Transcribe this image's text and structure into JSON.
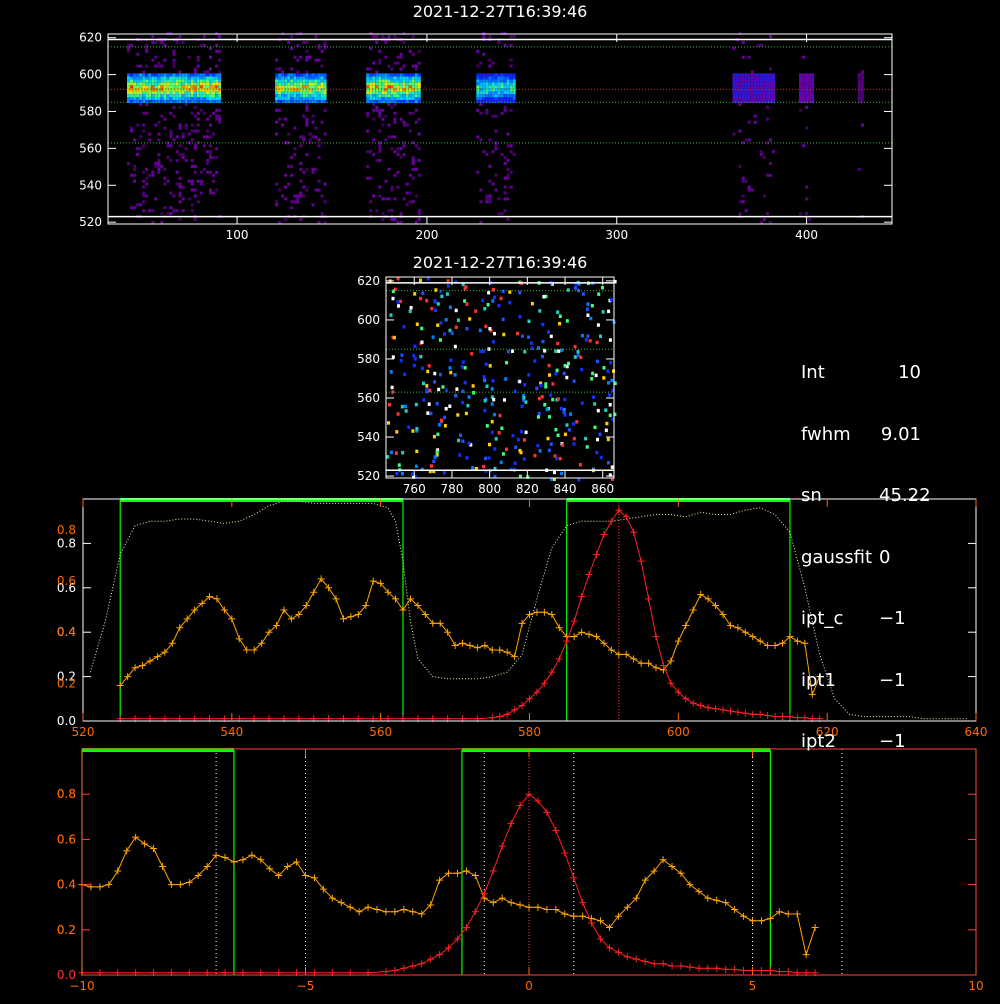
{
  "timestamp": "2021-12-27T16:39:46",
  "info_panel": [
    {
      "key": "Int",
      "value": "10"
    },
    {
      "key": "fwhm",
      "value": "9.01"
    },
    {
      "key": "sn",
      "value": "45.22"
    },
    {
      "key": "gaussfit",
      "value": "0"
    },
    {
      "key": "ipt_c",
      "value": "−1"
    },
    {
      "key": "ipt1",
      "value": "−1"
    },
    {
      "key": "ipt2",
      "value": "−1"
    }
  ],
  "colors": {
    "frame": "#ffffff",
    "window": "#00ff00",
    "line_profile": "#ff2020",
    "spectrum": "#ffa500",
    "transmission": "#e0ffb0",
    "left_axis_orange": "#ff6a00",
    "left_axis_red": "#ff3030"
  },
  "chart_data": [
    {
      "type": "heatmap",
      "title": "2021-12-27T16:39:46",
      "xlim": [
        32,
        445
      ],
      "ylim": [
        519,
        622
      ],
      "xticks": [
        100,
        200,
        300,
        400
      ],
      "yticks": [
        520,
        540,
        560,
        580,
        600,
        620
      ],
      "strong_rows": [
        584,
        600
      ],
      "faint_rows": [
        522,
        618
      ],
      "columns": [
        {
          "x0": 42,
          "x1": 91,
          "strength": 1.0
        },
        {
          "x0": 120,
          "x1": 147,
          "strength": 0.95
        },
        {
          "x0": 168,
          "x1": 196,
          "strength": 1.0
        },
        {
          "x0": 226,
          "x1": 246,
          "strength": 0.75
        },
        {
          "x0": 361,
          "x1": 383,
          "strength": 0.25
        },
        {
          "x0": 396,
          "x1": 404,
          "strength": 0.2
        },
        {
          "x0": 427,
          "x1": 429,
          "strength": 0.1
        }
      ],
      "hlines": [
        {
          "y": 523,
          "style": "solid-white"
        },
        {
          "y": 563,
          "style": "dotted-green"
        },
        {
          "y": 585,
          "style": "dotted-green"
        },
        {
          "y": 592,
          "style": "dotted-red"
        },
        {
          "y": 615,
          "style": "dotted-green"
        },
        {
          "y": 619,
          "style": "solid-white"
        }
      ]
    },
    {
      "type": "scatter",
      "title": "2021-12-27T16:39:46",
      "xlim": [
        745,
        866
      ],
      "ylim": [
        519,
        622
      ],
      "xticks": [
        760,
        780,
        800,
        820,
        840,
        860
      ],
      "yticks": [
        520,
        540,
        560,
        580,
        600,
        620
      ],
      "hlines": [
        {
          "y": 523,
          "style": "solid-white"
        },
        {
          "y": 563,
          "style": "dotted-green"
        },
        {
          "y": 585,
          "style": "dotted-green"
        },
        {
          "y": 615,
          "style": "dotted-green"
        },
        {
          "y": 619,
          "style": "solid-white"
        }
      ]
    },
    {
      "type": "line",
      "xlim": [
        520,
        640
      ],
      "ylim": [
        0,
        1.0
      ],
      "xticks": [
        520,
        540,
        560,
        580,
        600,
        620,
        640
      ],
      "yticks_white": [
        "0.0",
        "0.2",
        "0.4",
        "0.6",
        "0.8"
      ],
      "yticks_orange": [
        "0.2",
        "0.4",
        "0.6",
        "0.8"
      ],
      "windows": [
        {
          "x0": 525,
          "x1": 563
        },
        {
          "x0": 585,
          "x1": 615
        }
      ],
      "center_line_x": 592,
      "series": [
        {
          "role": "transmission",
          "x": [
            521,
            523,
            525,
            527,
            529,
            531,
            533,
            535,
            537,
            539,
            541,
            543,
            545,
            547,
            549,
            551,
            553,
            555,
            557,
            559,
            561,
            562,
            563,
            564,
            565,
            567,
            569,
            571,
            573,
            575,
            577,
            579,
            581,
            583,
            585,
            587,
            589,
            591,
            593,
            595,
            597,
            599,
            601,
            603,
            605,
            607,
            609,
            611,
            613,
            615,
            617,
            619,
            621,
            623,
            625,
            627,
            629,
            631,
            633,
            635,
            637,
            639
          ],
          "y": [
            0.22,
            0.45,
            0.75,
            0.88,
            0.9,
            0.9,
            0.91,
            0.91,
            0.9,
            0.89,
            0.9,
            0.93,
            0.97,
            0.99,
            0.99,
            0.98,
            0.98,
            0.98,
            0.98,
            0.98,
            0.96,
            0.9,
            0.72,
            0.45,
            0.28,
            0.2,
            0.19,
            0.19,
            0.19,
            0.2,
            0.22,
            0.3,
            0.55,
            0.78,
            0.88,
            0.9,
            0.9,
            0.9,
            0.91,
            0.92,
            0.93,
            0.93,
            0.92,
            0.94,
            0.93,
            0.93,
            0.95,
            0.96,
            0.93,
            0.85,
            0.6,
            0.3,
            0.1,
            0.03,
            0.02,
            0.02,
            0.02,
            0.02,
            0.01,
            0.01,
            0.01,
            0.01
          ]
        },
        {
          "role": "spectrum",
          "x": [
            525,
            526,
            527,
            528,
            529,
            530,
            531,
            532,
            533,
            534,
            535,
            536,
            537,
            538,
            539,
            540,
            541,
            542,
            543,
            544,
            545,
            546,
            547,
            548,
            549,
            550,
            551,
            552,
            553,
            554,
            555,
            556,
            557,
            558,
            559,
            560,
            561,
            562,
            563,
            564,
            565,
            566,
            567,
            568,
            569,
            570,
            571,
            572,
            573,
            574,
            575,
            576,
            577,
            578,
            579,
            580,
            581,
            582,
            583,
            584,
            585,
            586,
            587,
            588,
            589,
            590,
            591,
            592,
            593,
            594,
            595,
            596,
            597,
            598,
            599,
            600,
            601,
            602,
            603,
            604,
            605,
            606,
            607,
            608,
            609,
            610,
            611,
            612,
            613,
            614,
            615,
            616,
            617,
            618,
            619
          ],
          "y": [
            0.16,
            0.2,
            0.24,
            0.25,
            0.27,
            0.29,
            0.31,
            0.35,
            0.42,
            0.46,
            0.5,
            0.53,
            0.56,
            0.55,
            0.5,
            0.46,
            0.37,
            0.32,
            0.32,
            0.35,
            0.4,
            0.43,
            0.5,
            0.46,
            0.48,
            0.52,
            0.58,
            0.64,
            0.6,
            0.55,
            0.46,
            0.47,
            0.48,
            0.52,
            0.63,
            0.62,
            0.58,
            0.55,
            0.5,
            0.55,
            0.52,
            0.48,
            0.44,
            0.44,
            0.4,
            0.34,
            0.35,
            0.34,
            0.33,
            0.34,
            0.32,
            0.32,
            0.31,
            0.29,
            0.44,
            0.48,
            0.49,
            0.49,
            0.48,
            0.42,
            0.38,
            0.38,
            0.4,
            0.39,
            0.38,
            0.35,
            0.32,
            0.3,
            0.3,
            0.28,
            0.26,
            0.26,
            0.24,
            0.23,
            0.27,
            0.36,
            0.43,
            0.5,
            0.57,
            0.55,
            0.52,
            0.48,
            0.43,
            0.42,
            0.4,
            0.38,
            0.36,
            0.34,
            0.34,
            0.35,
            0.38,
            0.36,
            0.35,
            0.12,
            0.2
          ]
        },
        {
          "role": "line_profile",
          "x": [
            525,
            527,
            529,
            531,
            533,
            535,
            537,
            539,
            541,
            543,
            545,
            547,
            549,
            551,
            553,
            555,
            557,
            559,
            561,
            563,
            565,
            567,
            569,
            571,
            573,
            575,
            576,
            577,
            578,
            579,
            580,
            581,
            582,
            583,
            584,
            585,
            586,
            587,
            588,
            589,
            590,
            591,
            592,
            593,
            594,
            595,
            596,
            597,
            598,
            599,
            600,
            601,
            602,
            603,
            604,
            605,
            606,
            607,
            608,
            609,
            610,
            611,
            612,
            613,
            614,
            615,
            616,
            617,
            618,
            619
          ],
          "y": [
            0.01,
            0.01,
            0.01,
            0.01,
            0.01,
            0.01,
            0.01,
            0.01,
            0.01,
            0.01,
            0.01,
            0.01,
            0.01,
            0.01,
            0.01,
            0.01,
            0.01,
            0.01,
            0.01,
            0.01,
            0.01,
            0.01,
            0.01,
            0.01,
            0.01,
            0.015,
            0.02,
            0.03,
            0.05,
            0.07,
            0.1,
            0.13,
            0.17,
            0.22,
            0.28,
            0.36,
            0.45,
            0.56,
            0.66,
            0.75,
            0.84,
            0.9,
            0.95,
            0.92,
            0.85,
            0.72,
            0.55,
            0.38,
            0.25,
            0.17,
            0.13,
            0.1,
            0.08,
            0.07,
            0.06,
            0.055,
            0.05,
            0.045,
            0.04,
            0.035,
            0.03,
            0.03,
            0.025,
            0.02,
            0.02,
            0.02,
            0.015,
            0.015,
            0.01,
            0.01
          ]
        }
      ]
    },
    {
      "type": "line",
      "xlim": [
        -10,
        10
      ],
      "ylim": [
        0,
        1.0
      ],
      "xticks": [
        -10,
        -5,
        0,
        5,
        10
      ],
      "yticks_orange": [
        "0.2",
        "0.4",
        "0.6",
        "0.8"
      ],
      "yticks_red": [
        "0.0",
        "0.2",
        "0.4",
        "0.6",
        "0.8"
      ],
      "windows": [
        {
          "x0": -10,
          "x1": -6.6
        },
        {
          "x0": -1.5,
          "x1": 5.4
        }
      ],
      "center_line_x": 0,
      "dotted_vlines": [
        -7,
        -5,
        -1,
        1,
        5,
        7
      ],
      "series": [
        {
          "role": "spectrum",
          "x": [
            -10,
            -9.8,
            -9.6,
            -9.4,
            -9.2,
            -9.0,
            -8.8,
            -8.6,
            -8.4,
            -8.2,
            -8.0,
            -7.8,
            -7.6,
            -7.4,
            -7.2,
            -7.0,
            -6.8,
            -6.6,
            -6.4,
            -6.2,
            -6.0,
            -5.8,
            -5.6,
            -5.4,
            -5.2,
            -5.0,
            -4.8,
            -4.6,
            -4.4,
            -4.2,
            -4.0,
            -3.8,
            -3.6,
            -3.4,
            -3.2,
            -3.0,
            -2.8,
            -2.6,
            -2.4,
            -2.2,
            -2.0,
            -1.8,
            -1.6,
            -1.4,
            -1.2,
            -1.0,
            -0.8,
            -0.6,
            -0.4,
            -0.2,
            0.0,
            0.2,
            0.4,
            0.6,
            0.8,
            1.0,
            1.2,
            1.4,
            1.6,
            1.8,
            2.0,
            2.2,
            2.4,
            2.6,
            2.8,
            3.0,
            3.2,
            3.4,
            3.6,
            3.8,
            4.0,
            4.2,
            4.4,
            4.6,
            4.8,
            5.0,
            5.2,
            5.4,
            5.6,
            5.8,
            6.0,
            6.2,
            6.4
          ],
          "y": [
            0.4,
            0.39,
            0.39,
            0.4,
            0.46,
            0.55,
            0.61,
            0.58,
            0.56,
            0.48,
            0.4,
            0.4,
            0.41,
            0.44,
            0.48,
            0.53,
            0.52,
            0.5,
            0.51,
            0.53,
            0.51,
            0.47,
            0.44,
            0.48,
            0.5,
            0.44,
            0.43,
            0.38,
            0.34,
            0.32,
            0.3,
            0.28,
            0.3,
            0.29,
            0.28,
            0.28,
            0.29,
            0.28,
            0.27,
            0.31,
            0.42,
            0.45,
            0.45,
            0.46,
            0.44,
            0.34,
            0.32,
            0.34,
            0.32,
            0.31,
            0.3,
            0.3,
            0.29,
            0.29,
            0.27,
            0.26,
            0.26,
            0.25,
            0.24,
            0.21,
            0.26,
            0.3,
            0.34,
            0.42,
            0.46,
            0.51,
            0.48,
            0.45,
            0.4,
            0.37,
            0.34,
            0.33,
            0.32,
            0.29,
            0.26,
            0.24,
            0.24,
            0.25,
            0.28,
            0.27,
            0.27,
            0.09,
            0.21
          ]
        },
        {
          "role": "line_profile",
          "x": [
            -10,
            -9.6,
            -9.2,
            -8.8,
            -8.4,
            -8.0,
            -7.6,
            -7.2,
            -6.8,
            -6.4,
            -6.0,
            -5.6,
            -5.2,
            -4.8,
            -4.4,
            -4.0,
            -3.6,
            -3.2,
            -3.0,
            -2.8,
            -2.6,
            -2.4,
            -2.2,
            -2.0,
            -1.8,
            -1.6,
            -1.4,
            -1.2,
            -1.0,
            -0.8,
            -0.6,
            -0.4,
            -0.2,
            0.0,
            0.2,
            0.4,
            0.6,
            0.8,
            1.0,
            1.2,
            1.4,
            1.6,
            1.8,
            2.0,
            2.2,
            2.4,
            2.6,
            2.8,
            3.0,
            3.2,
            3.4,
            3.6,
            3.8,
            4.0,
            4.2,
            4.4,
            4.6,
            4.8,
            5.0,
            5.2,
            5.4,
            5.6,
            5.8,
            6.0,
            6.2,
            6.4
          ],
          "y": [
            0.01,
            0.01,
            0.01,
            0.01,
            0.01,
            0.01,
            0.01,
            0.01,
            0.01,
            0.01,
            0.01,
            0.01,
            0.01,
            0.01,
            0.01,
            0.01,
            0.01,
            0.015,
            0.02,
            0.03,
            0.04,
            0.05,
            0.07,
            0.09,
            0.12,
            0.16,
            0.21,
            0.28,
            0.36,
            0.46,
            0.57,
            0.67,
            0.75,
            0.8,
            0.77,
            0.72,
            0.64,
            0.54,
            0.43,
            0.32,
            0.23,
            0.16,
            0.12,
            0.1,
            0.08,
            0.07,
            0.06,
            0.05,
            0.05,
            0.04,
            0.04,
            0.035,
            0.03,
            0.03,
            0.03,
            0.025,
            0.025,
            0.02,
            0.02,
            0.02,
            0.02,
            0.015,
            0.015,
            0.01,
            0.01,
            0.01
          ]
        }
      ]
    }
  ]
}
